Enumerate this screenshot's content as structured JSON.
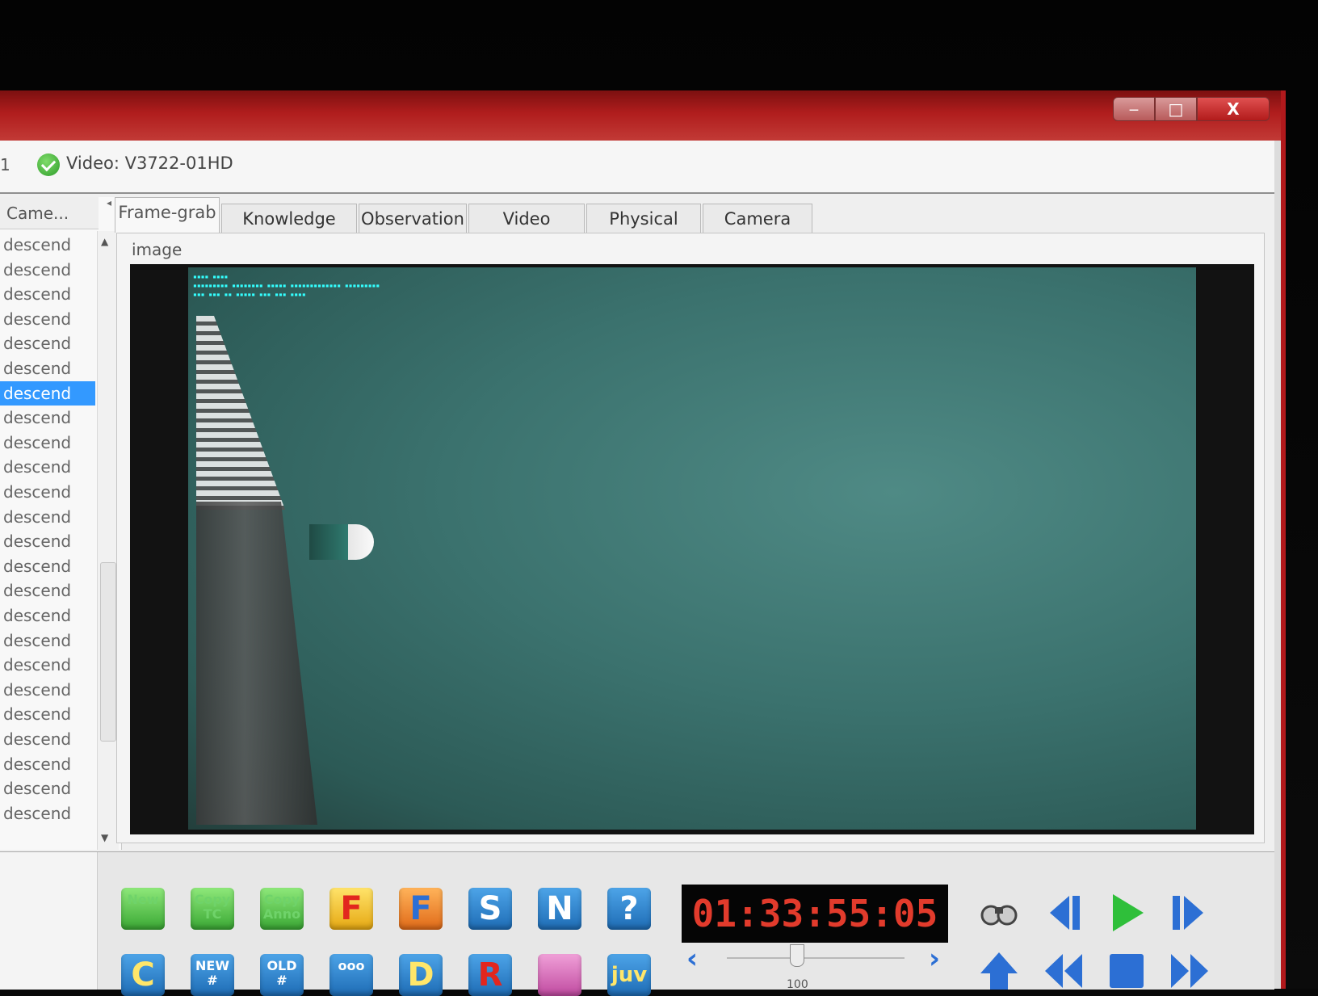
{
  "window": {
    "min_glyph": "‒",
    "max_glyph": "□",
    "close_glyph": "X"
  },
  "infobar": {
    "left_fragment": "1",
    "video_label": "Video: V3722-01HD"
  },
  "left_panel": {
    "column_header": "Came...",
    "items": [
      "descend",
      "descend",
      "descend",
      "descend",
      "descend",
      "descend",
      "descend",
      "descend",
      "descend",
      "descend",
      "descend",
      "descend",
      "descend",
      "descend",
      "descend",
      "descend",
      "descend",
      "descend",
      "descend",
      "descend",
      "descend",
      "descend",
      "descend",
      "descend"
    ],
    "selected_index": 6
  },
  "tabs": [
    "Frame-grab",
    "Knowledge Base",
    "Observation",
    "Video Archive",
    "Physical Data",
    "Camera Data"
  ],
  "active_tab": 0,
  "image_section_label": "image",
  "toolbar": {
    "row1": [
      {
        "label": "New",
        "style": "green"
      },
      {
        "label": "Copy TC",
        "style": "green"
      },
      {
        "label": "Copy Anno",
        "style": "green"
      },
      {
        "label": "F",
        "style": "yellow"
      },
      {
        "label": "F",
        "style": "orange-x"
      },
      {
        "label": "S",
        "style": "blue"
      },
      {
        "label": "N",
        "style": "blue"
      },
      {
        "label": "?",
        "style": "blue"
      }
    ],
    "row2": [
      {
        "label": "C",
        "style": "blue"
      },
      {
        "label": "NEW #",
        "style": "blue"
      },
      {
        "label": "OLD #",
        "style": "blue"
      },
      {
        "label": "ooo",
        "style": "blue"
      },
      {
        "label": "D",
        "style": "blue"
      },
      {
        "label": "R",
        "style": "blue"
      },
      {
        "label": "",
        "style": "pink-hand"
      },
      {
        "label": "juv",
        "style": "blue"
      }
    ],
    "timecode": "01:33:55:05",
    "slider_value_label": "100",
    "step_back_glyph": "‹",
    "step_forward_glyph": "›"
  },
  "icons": {
    "binoculars": "binoculars-icon",
    "play": "play-icon",
    "stop": "stop-icon",
    "rewind": "rewind-icon",
    "fast_forward": "fast-forward-icon",
    "step_back": "step-back-icon",
    "step_forward": "step-forward-icon",
    "eject": "eject-icon"
  },
  "colors": {
    "title_bar": "#b01d1d",
    "selected_row": "#3399ff",
    "timecode_text": "#e23b2c",
    "control_blue": "#2c6fd4",
    "play_green": "#2fbf3a"
  }
}
